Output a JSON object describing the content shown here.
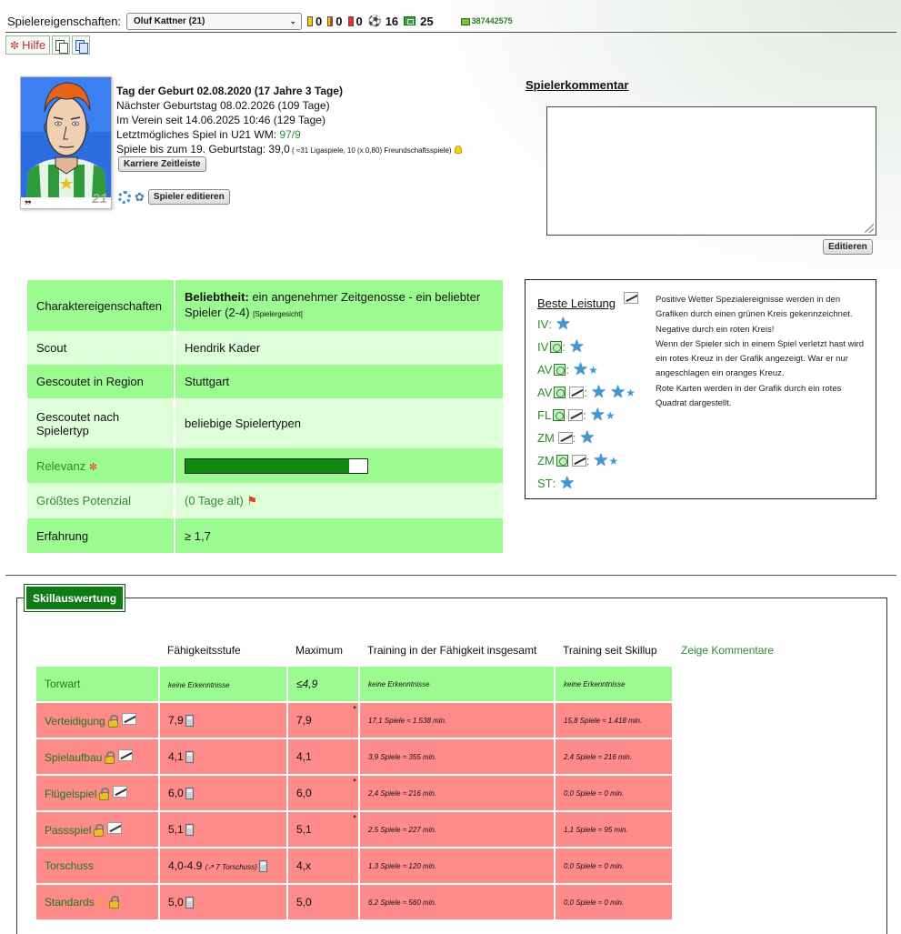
{
  "header": {
    "label": "Spielereigenschaften:",
    "player_select": "Oluf Kattner (21)",
    "yellow_cards": "0",
    "yellow_red_cards": "0",
    "red_cards": "0",
    "goals": "16",
    "matches": "25",
    "money": "387442575"
  },
  "toolbar": {
    "help_label": "Hilfe"
  },
  "player": {
    "shirt_number": "21",
    "birthday_line": "Tag der Geburt 02.08.2020 (17 Jahre 3 Tage)",
    "next_birthday": "Nächster Geburtstag 08.02.2026 (109 Tage)",
    "in_club": "Im Verein seit 14.06.2025 10:46 (129 Tage)",
    "u21_label": "Letztmögliches Spiel in U21 WM: ",
    "u21_value": "97/9",
    "games_label": "Spiele bis zum 19. Geburtstag: 39,0",
    "games_detail": " ( ≈31 Ligaspiele, 10 (x 0,80) Freundschaftsspiele)",
    "career_button": "Karriere Zeitleiste",
    "edit_button": "Spieler editieren"
  },
  "comment": {
    "title": "Spielerkommentar",
    "edit_button": "Editieren"
  },
  "attributes": {
    "character_label": "Charaktereigenschaften",
    "character_bold": "Beliebtheit:",
    "character_text": " ein angenehmer Zeitgenosse - ein beliebter Spieler (2-4) ",
    "character_small": "[Spielergesicht]",
    "scout_label": "Scout",
    "scout_value": "Hendrik Kader",
    "region_label": "Gescoutet in Region",
    "region_value": "Stuttgart",
    "type_label": "Gescoutet nach Spielertyp",
    "type_value": "beliebige Spielertypen",
    "relevance_label": "Relevanz",
    "relevance_fraction": 0.9,
    "potential_label": "Größtes Potenzial",
    "potential_value": "(0 Tage alt)",
    "experience_label": "Erfahrung",
    "experience_value": "≥ 1,7"
  },
  "best": {
    "title": "Beste Leistung",
    "rows": [
      {
        "pos": "IV",
        "stars": "1"
      },
      {
        "pos": "IV",
        "stars": "1"
      },
      {
        "pos": "AV",
        "stars": "1.5"
      },
      {
        "pos": "AV",
        "stars": "2.5"
      },
      {
        "pos": "FL",
        "stars": "1.5"
      },
      {
        "pos": "ZM",
        "stars": "1"
      },
      {
        "pos": "ZM",
        "stars": "1.5"
      },
      {
        "pos": "ST",
        "stars": "1"
      }
    ],
    "note_1": "Positive Wetter Spezialereignisse werden in den Grafiken durch einen grünen Kreis gekennzeichnet.",
    "note_2": "Negative durch ein roten Kreis!",
    "note_3": "Wenn der Spieler sich in einem Spiel verletzt hast wird ein rotes Kreuz in der Grafik angezeigt. War er nur angeschlagen ein oranges Kreuz.",
    "note_4": "Rote Karten werden in der Grafik durch ein rotes Quadrat dargestellt."
  },
  "skills": {
    "tab_title": "Skillauswertung",
    "headers": {
      "level": "Fähigkeitsstufe",
      "max": "Maximum",
      "training_total": "Training in der Fähigkeit insgesamt",
      "training_since": "Training seit Skillup",
      "comments_link": "Zeige Kommentare"
    },
    "rows": [
      {
        "name": "Torwart",
        "level": "keine Erkenntnisse",
        "max": "≤4,9",
        "t1": "keine Erkenntnisse",
        "t2": "keine Erkenntnisse"
      },
      {
        "name": "Verteidigung",
        "level": "7,9",
        "max": "7,9",
        "t1": "17,1 Spiele ≈ 1.538 min.",
        "t2": "15,8 Spiele ≈ 1.418 min."
      },
      {
        "name": "Spielaufbau",
        "level": "4,1",
        "max": "4,1",
        "t1": "3,9 Spiele ≈ 355 min.",
        "t2": "2,4 Spiele ≈ 216 min."
      },
      {
        "name": "Flügelspiel",
        "level": "6,0",
        "max": "6,0",
        "t1": "2,4 Spiele ≈ 216 min.",
        "t2": "0,0 Spiele ≈ 0 min."
      },
      {
        "name": "Passspiel",
        "level": "5,1",
        "max": "5,1",
        "t1": "2,5 Spiele ≈ 227 min.",
        "t2": "1,1 Spiele ≈ 95 min."
      },
      {
        "name": "Torschuss",
        "level": "4,0-4.9",
        "level_note": "(↗ 7 Torschuss)",
        "max": "4,x",
        "t1": "1,3 Spiele ≈ 120 min.",
        "t2": "0,0 Spiele ≈ 0 min."
      },
      {
        "name": "Standards",
        "level": "5,0",
        "max": "5,0",
        "t1": "6,2 Spiele ≈ 560 min.",
        "t2": "0,0 Spiele ≈ 0 min."
      }
    ]
  }
}
